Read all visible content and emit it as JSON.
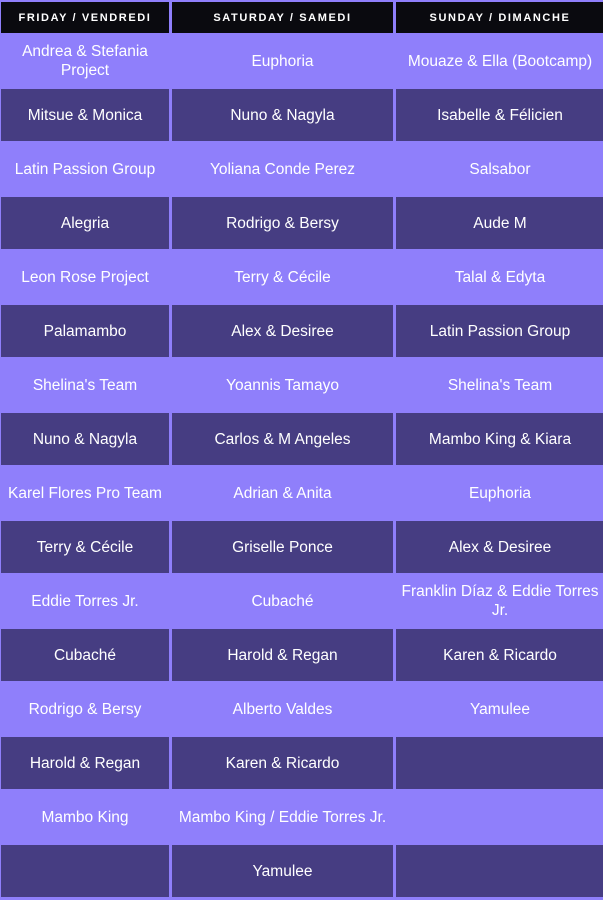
{
  "headers": [
    "FRIDAY / VENDREDI",
    "SATURDAY / SAMEDI",
    "SUNDAY / DIMANCHE"
  ],
  "rows": [
    [
      "Andrea & Stefania Project",
      "Euphoria",
      "Mouaze & Ella (Bootcamp)"
    ],
    [
      "Mitsue & Monica",
      "Nuno & Nagyla",
      "Isabelle & Félicien"
    ],
    [
      "Latin Passion Group",
      "Yoliana Conde Perez",
      "Salsabor"
    ],
    [
      "Alegria",
      "Rodrigo & Bersy",
      "Aude M"
    ],
    [
      "Leon Rose Project",
      "Terry & Cécile",
      "Talal & Edyta"
    ],
    [
      "Palamambo",
      "Alex & Desiree",
      "Latin Passion Group"
    ],
    [
      "Shelina's Team",
      "Yoannis Tamayo",
      "Shelina's Team"
    ],
    [
      "Nuno & Nagyla",
      "Carlos & M Angeles",
      "Mambo King & Kiara"
    ],
    [
      "Karel Flores Pro Team",
      "Adrian & Anita",
      "Euphoria"
    ],
    [
      "Terry & Cécile",
      "Griselle Ponce",
      "Alex & Desiree"
    ],
    [
      "Eddie Torres Jr.",
      "Cubaché",
      "Franklin Díaz & Eddie Torres Jr."
    ],
    [
      "Cubaché",
      "Harold & Regan",
      "Karen & Ricardo"
    ],
    [
      "Rodrigo & Bersy",
      "Alberto Valdes",
      "Yamulee"
    ],
    [
      "Harold & Regan",
      "Karen & Ricardo",
      ""
    ],
    [
      "Mambo King",
      "Mambo King / Eddie Torres Jr.",
      ""
    ],
    [
      "",
      "Yamulee",
      ""
    ]
  ],
  "colors": {
    "light_row": "#8f7ffb",
    "dark_row": "#463d82",
    "header": "#0a0a0f",
    "text": "#ffffff"
  }
}
